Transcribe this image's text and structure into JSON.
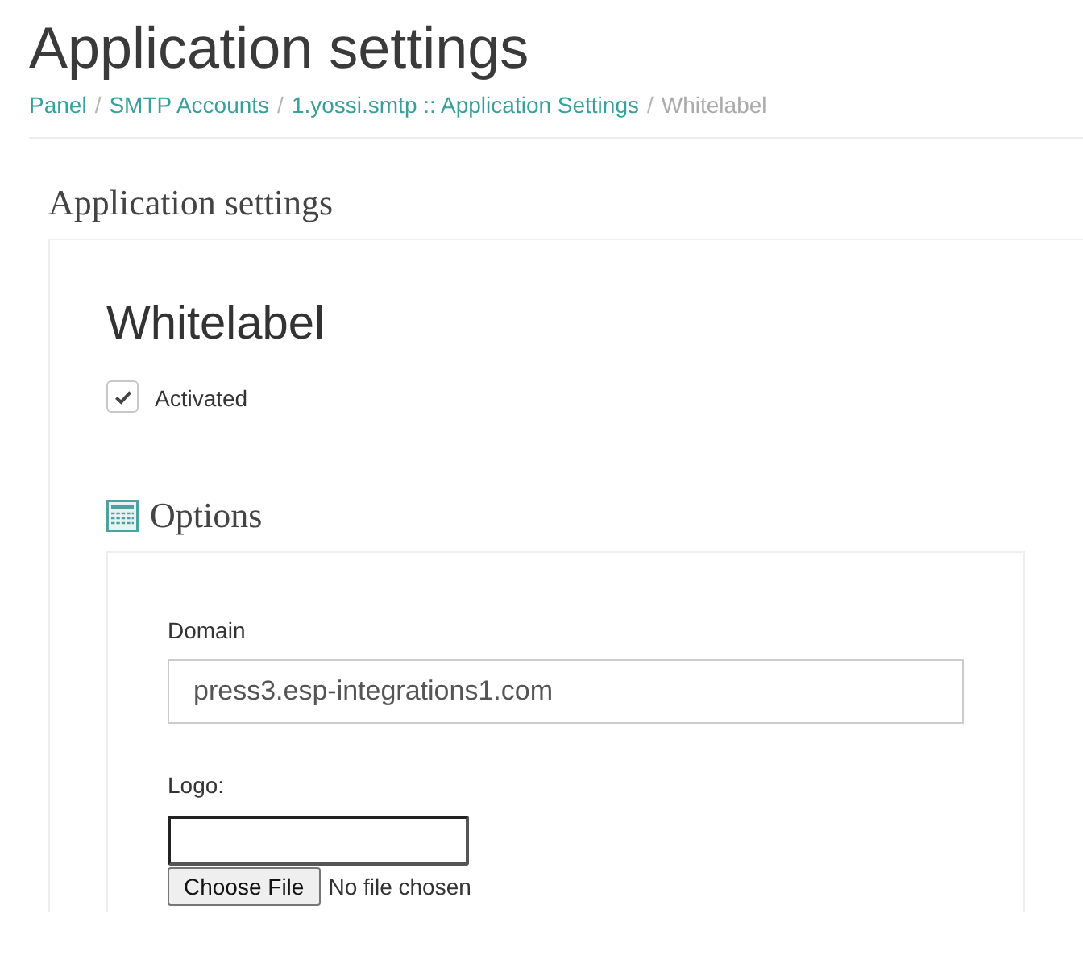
{
  "page_title": "Application settings",
  "breadcrumb": {
    "separator": "/",
    "items": [
      {
        "label": "Panel",
        "current": false
      },
      {
        "label": "SMTP Accounts",
        "current": false
      },
      {
        "label": "1.yossi.smtp :: Application Settings",
        "current": false
      },
      {
        "label": "Whitelabel",
        "current": true
      }
    ]
  },
  "section_heading": "Application settings",
  "panel": {
    "title": "Whitelabel",
    "activated": {
      "label": "Activated",
      "checked": true
    },
    "options": {
      "title": "Options",
      "fields": [
        {
          "kind": "text",
          "label": "Domain",
          "value": "press3.esp-integrations1.com"
        },
        {
          "kind": "file",
          "label": "Logo:",
          "button": "Choose File",
          "status": "No file chosen"
        }
      ]
    }
  }
}
